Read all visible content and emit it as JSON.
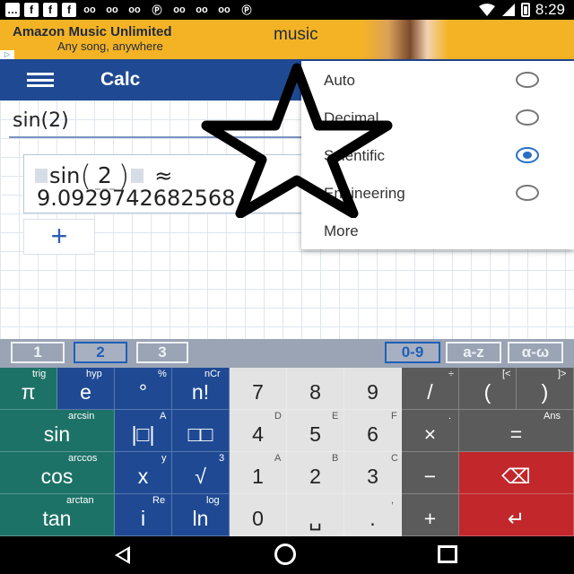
{
  "status_bar": {
    "time": "8:29",
    "icons": [
      "message-icon",
      "facebook-icon",
      "facebook-icon",
      "facebook-icon",
      "voicemail-icon",
      "voicemail-icon",
      "voicemail-icon",
      "pinterest-icon",
      "voicemail-icon",
      "voicemail-icon",
      "voicemail-icon",
      "pinterest-icon",
      "wifi-icon",
      "signal-icon",
      "battery-charging-icon"
    ]
  },
  "ad": {
    "title": "Amazon Music Unlimited",
    "subtitle": "Any song, anywhere",
    "brand": "music"
  },
  "app_bar": {
    "title": "Calc"
  },
  "input": {
    "expression": "sin(2)"
  },
  "result": {
    "function": "sin",
    "argument": "2",
    "approx": "≈",
    "value": "9.0929742682568"
  },
  "add_button": {
    "label": "+"
  },
  "dropdown": {
    "items": [
      {
        "label": "Auto",
        "selected": false
      },
      {
        "label": "Decimal",
        "selected": false
      },
      {
        "label": "Scientific",
        "selected": true
      },
      {
        "label": "Engineering",
        "selected": false
      },
      {
        "label": "More"
      }
    ]
  },
  "tabs": {
    "left": [
      "1",
      "2",
      "3"
    ],
    "right": [
      "0-9",
      "a-z",
      "α-ω"
    ],
    "active": "2"
  },
  "keys": {
    "r1": [
      {
        "main": "π",
        "sub": "trig"
      },
      {
        "main": "e",
        "sub": "hyp"
      },
      {
        "main": "°",
        "sub": "%"
      },
      {
        "main": "n!",
        "sub": "nCr"
      },
      {
        "main": "7",
        "sub": ""
      },
      {
        "main": "8",
        "sub": ""
      },
      {
        "main": "9",
        "sub": ""
      },
      {
        "main": "/",
        "sub": "÷"
      },
      {
        "main": "(",
        "sub": "[<"
      },
      {
        "main": ")",
        "sub": "]>"
      }
    ],
    "r2": [
      {
        "main": "sin",
        "sub": "arcsin"
      },
      {
        "main": "|□|",
        "sub": "A"
      },
      {
        "main": "□□",
        "sub": ""
      },
      {
        "main": "4",
        "sub": "D"
      },
      {
        "main": "5",
        "sub": "E"
      },
      {
        "main": "6",
        "sub": "F"
      },
      {
        "main": "×",
        "sub": "."
      },
      {
        "main": "=",
        "sub": "Ans"
      }
    ],
    "r3": [
      {
        "main": "cos",
        "sub": "arccos"
      },
      {
        "main": "x",
        "sub": "y"
      },
      {
        "main": "√",
        "sub": "3"
      },
      {
        "main": "1",
        "sub": "A"
      },
      {
        "main": "2",
        "sub": "B"
      },
      {
        "main": "3",
        "sub": "C"
      },
      {
        "main": "−",
        "sub": ""
      },
      {
        "main": "⌫",
        "sub": ""
      }
    ],
    "r4": [
      {
        "main": "tan",
        "sub": "arctan"
      },
      {
        "main": "i",
        "sub": "Re"
      },
      {
        "main": "ln",
        "sub": "log"
      },
      {
        "main": "0",
        "sub": ""
      },
      {
        "main": "␣",
        "sub": ""
      },
      {
        "main": ".",
        "sub": ","
      },
      {
        "main": "+",
        "sub": ""
      },
      {
        "main": "↵",
        "sub": ""
      }
    ]
  },
  "colors": {
    "app_bar": "#1f4a93",
    "radio_selected": "#2a6fc4",
    "key_teal": "#1d7267",
    "key_blue": "#1f4a93",
    "key_light": "#e3e3e3",
    "key_dark": "#5b5b5b",
    "key_red": "#c1272b"
  }
}
